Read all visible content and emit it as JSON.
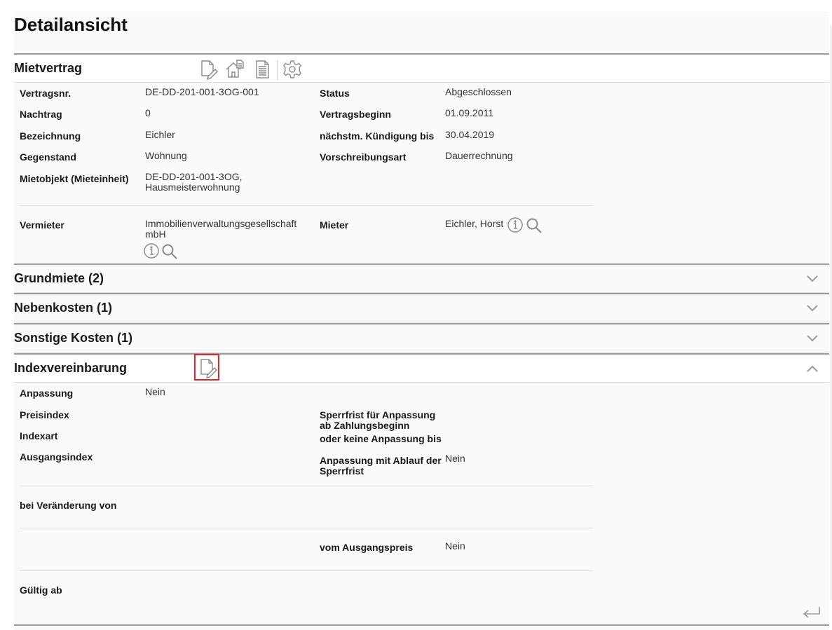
{
  "page": {
    "title": "Detailansicht"
  },
  "sections": {
    "mietvertrag": {
      "title": "Mietvertrag",
      "toolbar": [
        "edit-document-icon",
        "home-document-icon",
        "document-icon",
        "gear-icon"
      ],
      "fields": {
        "vertragsnr_label": "Vertragsnr.",
        "vertragsnr_value": "DE-DD-201-001-3OG-001",
        "nachtrag_label": "Nachtrag",
        "nachtrag_value": "0",
        "bezeichnung_label": "Bezeichnung",
        "bezeichnung_value": "Eichler",
        "gegenstand_label": "Gegenstand",
        "gegenstand_value": "Wohnung",
        "mietobjekt_label": "Mietobjekt (Mieteinheit)",
        "mietobjekt_value_1": "DE-DD-201-001-3OG,",
        "mietobjekt_value_2": "Hausmeisterwohnung",
        "status_label": "Status",
        "status_value": "Abgeschlossen",
        "vertragsbeginn_label": "Vertragsbeginn",
        "vertragsbeginn_value": "01.09.2011",
        "kuendigung_label": "nächstm. Kündigung bis",
        "kuendigung_value": "30.04.2019",
        "vorschreibungsart_label": "Vorschreibungsart",
        "vorschreibungsart_value": "Dauerrechnung",
        "vermieter_label": "Vermieter",
        "vermieter_value_1": "Immobilienverwaltungsgesellschaft",
        "vermieter_value_2": "mbH",
        "mieter_label": "Mieter",
        "mieter_value": "Eichler, Horst"
      }
    },
    "grundmiete": {
      "title": "Grundmiete (2)"
    },
    "nebenkosten": {
      "title": "Nebenkosten (1)"
    },
    "sonstige": {
      "title": "Sonstige Kosten (1)"
    },
    "indexvereinbarung": {
      "title": "Indexvereinbarung",
      "toolbar": [
        "edit-document-icon"
      ],
      "fields": {
        "anpassung_label": "Anpassung",
        "anpassung_value": "Nein",
        "preisindex_label": "Preisindex",
        "indexart_label": "Indexart",
        "ausgangsindex_label": "Ausgangsindex",
        "sperrfrist_label_1": "Sperrfrist für Anpassung",
        "sperrfrist_label_2": "ab Zahlungsbeginn",
        "keine_anpassung_label": "oder keine Anpassung bis",
        "ablauf_label_1": "Anpassung mit Ablauf der",
        "ablauf_label_2": "Sperrfrist",
        "ablauf_value": "Nein",
        "veraenderung_label": "bei Veränderung von",
        "ausgangspreis_label": "vom Ausgangspreis",
        "ausgangspreis_value": "Nein",
        "gueltig_label": "Gültig ab"
      }
    }
  },
  "colors": {
    "accent_selection": "#e0262a",
    "icon_gray": "#8a8a8a"
  }
}
